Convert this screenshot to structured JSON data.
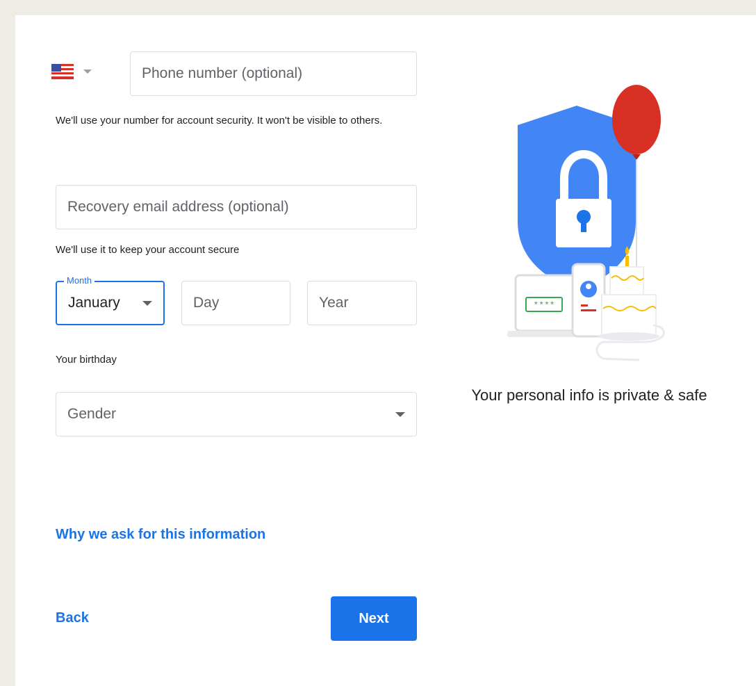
{
  "phone": {
    "country_flag": "us-flag-icon",
    "placeholder": "Phone number (optional)",
    "helper": "We'll use your number for account security. It won't be visible to others."
  },
  "recovery": {
    "placeholder": "Recovery email address (optional)",
    "helper": "We'll use it to keep your account secure"
  },
  "birthday": {
    "month_label": "Month",
    "month_value": "January",
    "day_placeholder": "Day",
    "year_placeholder": "Year",
    "helper": "Your birthday"
  },
  "gender": {
    "placeholder": "Gender"
  },
  "links": {
    "why": "Why we ask for this information",
    "back": "Back"
  },
  "actions": {
    "next": "Next"
  },
  "illustration": {
    "password_mask": "****",
    "caption": "Your personal info is private & safe"
  },
  "colors": {
    "accent": "#1a73e8",
    "shield": "#4285f4",
    "balloon": "#d93025",
    "page_bg": "#efebe5"
  }
}
